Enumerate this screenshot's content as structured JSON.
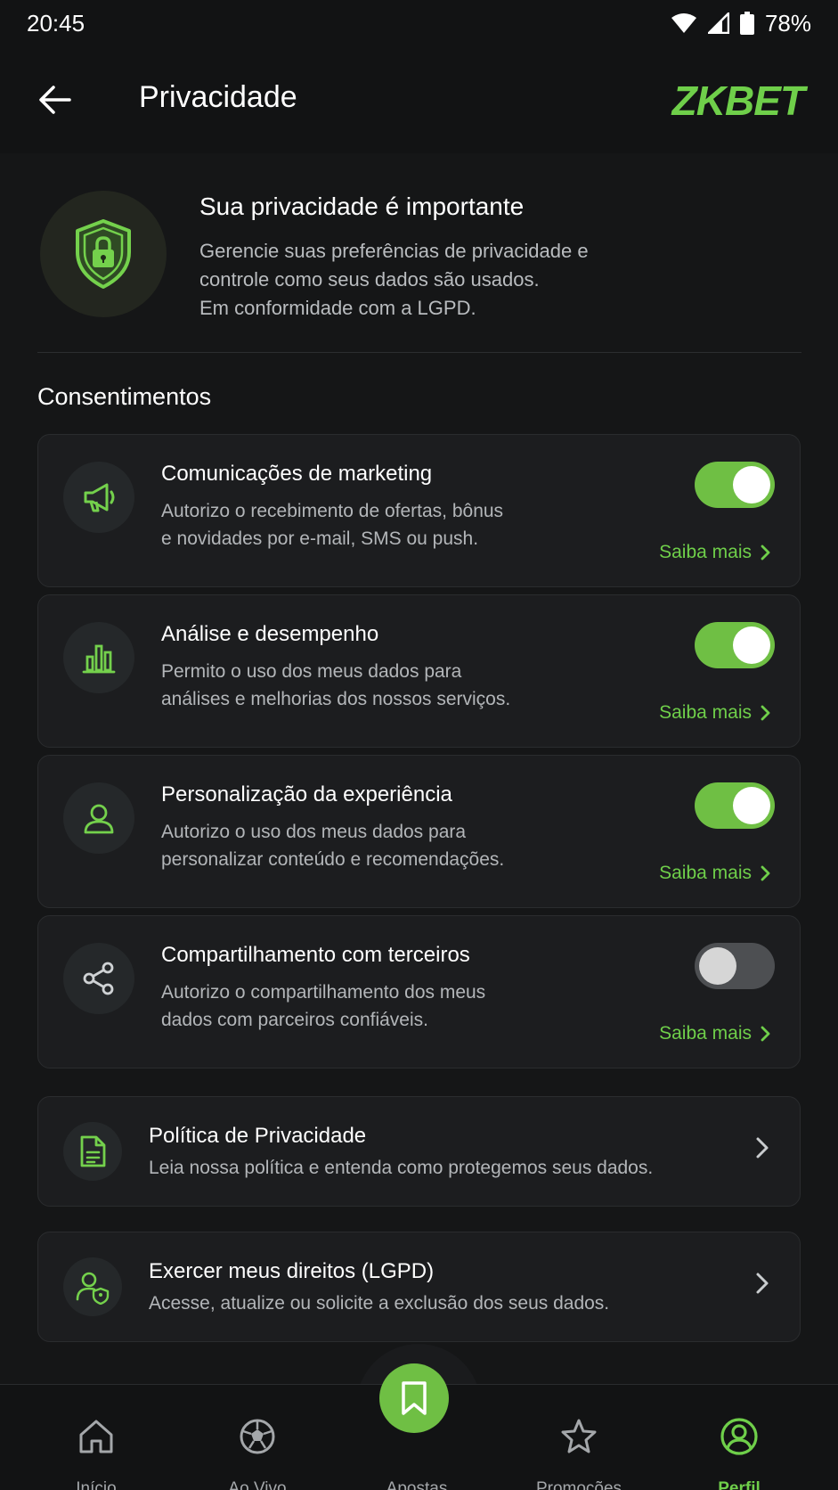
{
  "status": {
    "time": "20:45",
    "battery": "78%"
  },
  "header": {
    "title": "Privacidade",
    "brand_a": "ZK",
    "brand_b": "BET"
  },
  "hero": {
    "title": "Sua privacidade é importante",
    "line1": "Gerencie suas preferências de privacidade e",
    "line2": "controle como seus dados são usados.",
    "line3": "Em conformidade com a LGPD."
  },
  "consents": {
    "section_title": "Consentimentos",
    "saiba_mais": "Saiba mais",
    "items": [
      {
        "title": "Comunicações de marketing",
        "line1": "Autorizo o recebimento de ofertas, bônus",
        "line2": "e novidades por e-mail, SMS ou push.",
        "enabled": true,
        "icon": "megaphone-icon"
      },
      {
        "title": "Análise e desempenho",
        "line1": "Permito o uso dos meus dados para",
        "line2": "análises e melhorias dos nossos serviços.",
        "enabled": true,
        "icon": "bar-chart-icon"
      },
      {
        "title": "Personalização da experiência",
        "line1": "Autorizo o uso dos meus dados para",
        "line2": "personalizar conteúdo e recomendações.",
        "enabled": true,
        "icon": "user-icon"
      },
      {
        "title": "Compartilhamento com terceiros",
        "line1": "Autorizo o compartilhamento dos meus",
        "line2": "dados com parceiros confiáveis.",
        "enabled": false,
        "icon": "share-icon"
      }
    ]
  },
  "links": [
    {
      "title": "Política de Privacidade",
      "desc": "Leia nossa política e entenda como protegemos seus dados.",
      "icon": "document-icon"
    },
    {
      "title": "Exercer meus direitos (LGPD)",
      "desc": "Acesse, atualize ou solicite a exclusão dos seus dados.",
      "icon": "user-shield-icon"
    }
  ],
  "nav": {
    "items": [
      {
        "label": "Início",
        "icon": "home-icon"
      },
      {
        "label": "Ao Vivo",
        "icon": "soccer-ball-icon"
      },
      {
        "label": "Apostas",
        "icon": "bookmark-icon"
      },
      {
        "label": "Promoções",
        "icon": "star-icon"
      },
      {
        "label": "Perfil",
        "icon": "profile-icon"
      }
    ],
    "active": "Perfil"
  },
  "colors": {
    "accent": "#6fbf44",
    "background": "#151617",
    "card": "#1c1d1f"
  }
}
